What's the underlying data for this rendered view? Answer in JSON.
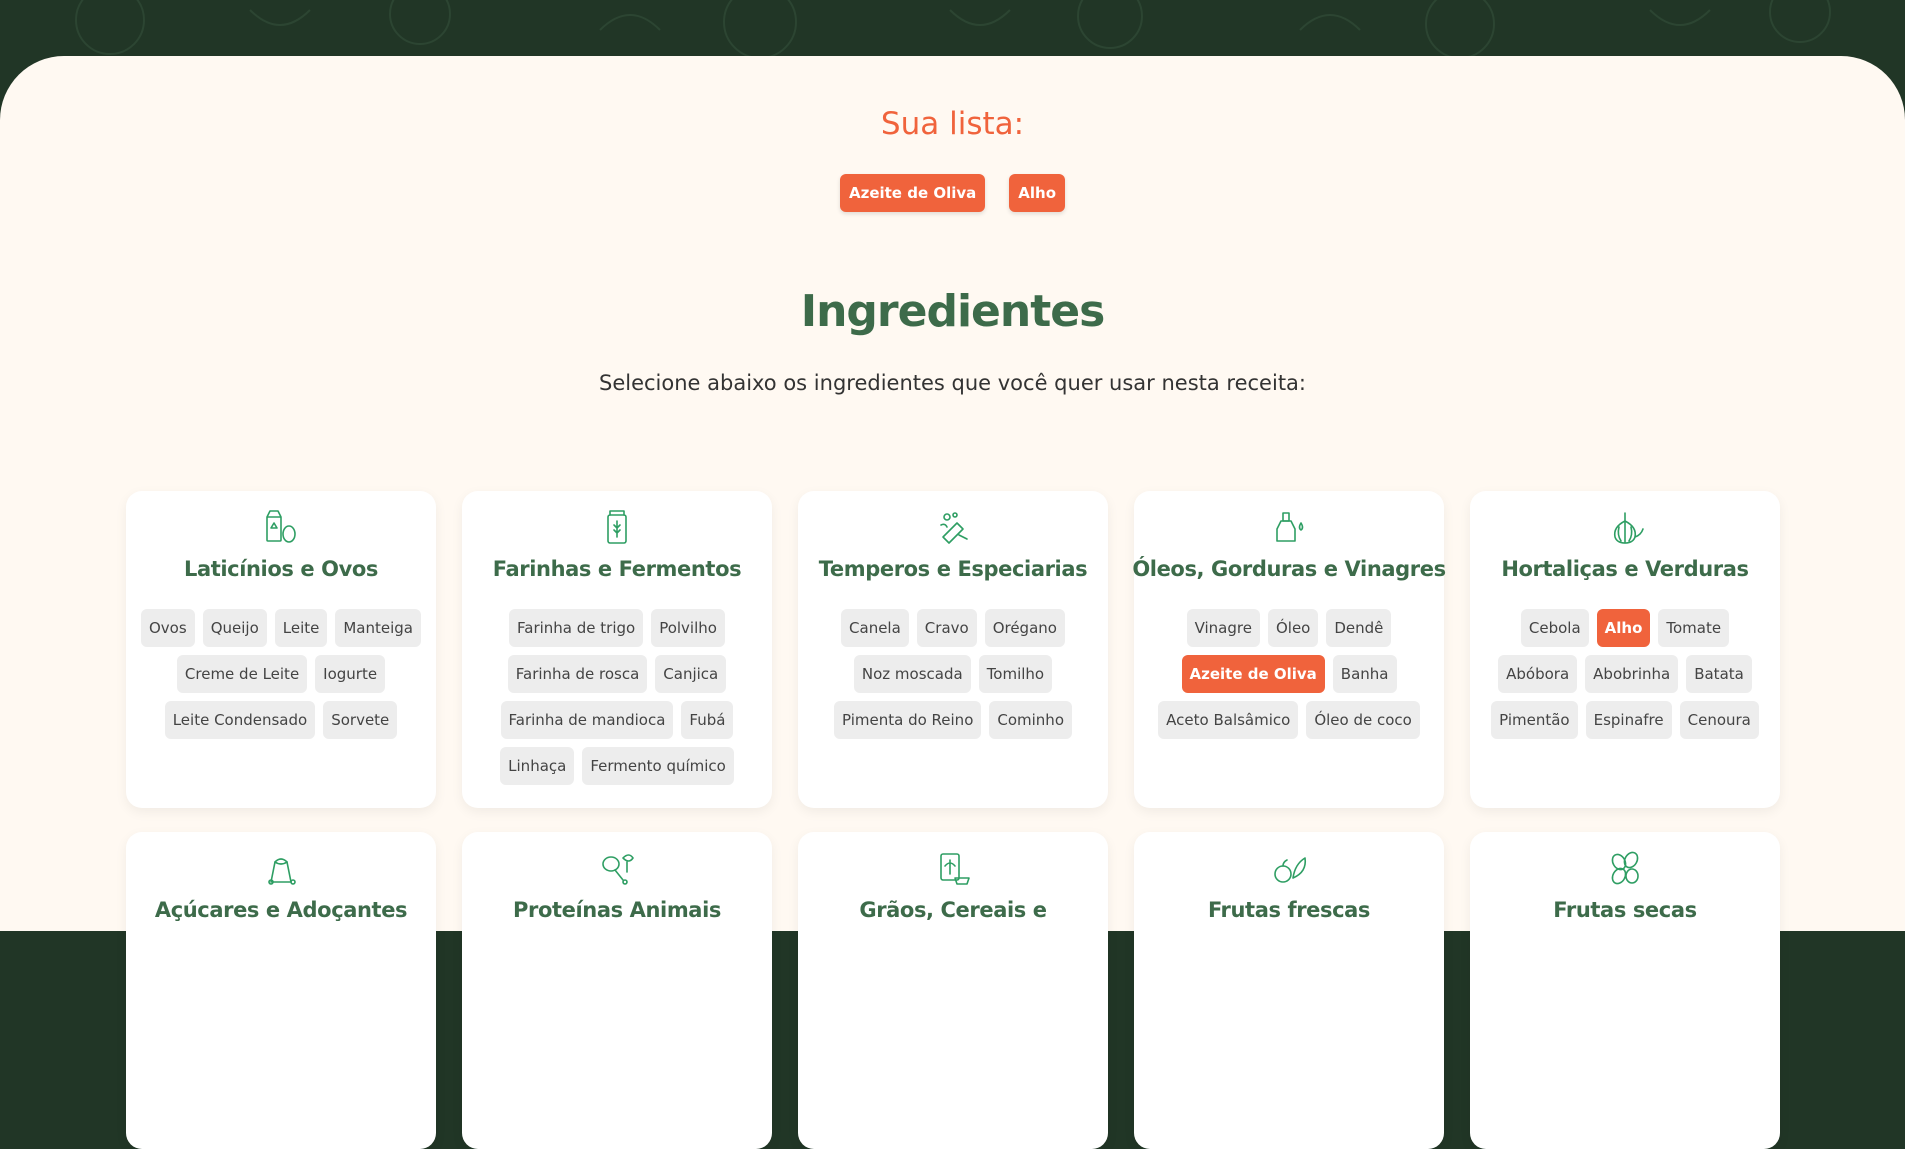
{
  "colors": {
    "accent": "#F0633C",
    "primary_green": "#3D6B4A",
    "header_dark": "#213626",
    "page_bg": "#FFF9F2",
    "tag_bg": "#EDEDED"
  },
  "list": {
    "title": "Sua lista:",
    "items": [
      "Azeite de Oliva",
      "Alho"
    ]
  },
  "ingredients": {
    "title": "Ingredientes",
    "subtitle": "Selecione abaixo os ingredientes que você quer usar nesta receita:"
  },
  "categories": [
    {
      "name": "Laticínios e Ovos",
      "icon": "milk-egg-icon",
      "items": [
        "Ovos",
        "Queijo",
        "Leite",
        "Manteiga",
        "Creme de Leite",
        "Iogurte",
        "Leite Condensado",
        "Sorvete"
      ],
      "selected": []
    },
    {
      "name": "Farinhas e Fermentos",
      "icon": "flour-jar-icon",
      "items": [
        "Farinha de trigo",
        "Polvilho",
        "Farinha de rosca",
        "Canjica",
        "Farinha de mandioca",
        "Fubá",
        "Linhaça",
        "Fermento químico"
      ],
      "selected": []
    },
    {
      "name": "Temperos e Especiarias",
      "icon": "spices-icon",
      "items": [
        "Canela",
        "Cravo",
        "Orégano",
        "Noz moscada",
        "Tomilho",
        "Pimenta do Reino",
        "Cominho"
      ],
      "selected": []
    },
    {
      "name": "Óleos, Gorduras e Vinagres",
      "icon": "oil-bottle-icon",
      "items": [
        "Vinagre",
        "Óleo",
        "Dendê",
        "Azeite de Oliva",
        "Banha",
        "Aceto Balsâmico",
        "Óleo de coco"
      ],
      "selected": [
        "Azeite de Oliva"
      ]
    },
    {
      "name": "Hortaliças e Verduras",
      "icon": "garlic-icon",
      "items": [
        "Cebola",
        "Alho",
        "Tomate",
        "Abóbora",
        "Abobrinha",
        "Batata",
        "Pimentão",
        "Espinafre",
        "Cenoura"
      ],
      "selected": [
        "Alho"
      ]
    },
    {
      "name": "Açúcares e Adoçantes",
      "icon": "sugar-bag-icon",
      "items": [],
      "selected": []
    },
    {
      "name": "Proteínas Animais",
      "icon": "meat-icon",
      "items": [],
      "selected": []
    },
    {
      "name": "Grãos, Cereais e",
      "icon": "grain-box-icon",
      "items": [],
      "selected": []
    },
    {
      "name": "Frutas frescas",
      "icon": "fresh-fruit-icon",
      "items": [],
      "selected": []
    },
    {
      "name": "Frutas secas",
      "icon": "dried-fruit-icon",
      "items": [],
      "selected": []
    }
  ]
}
